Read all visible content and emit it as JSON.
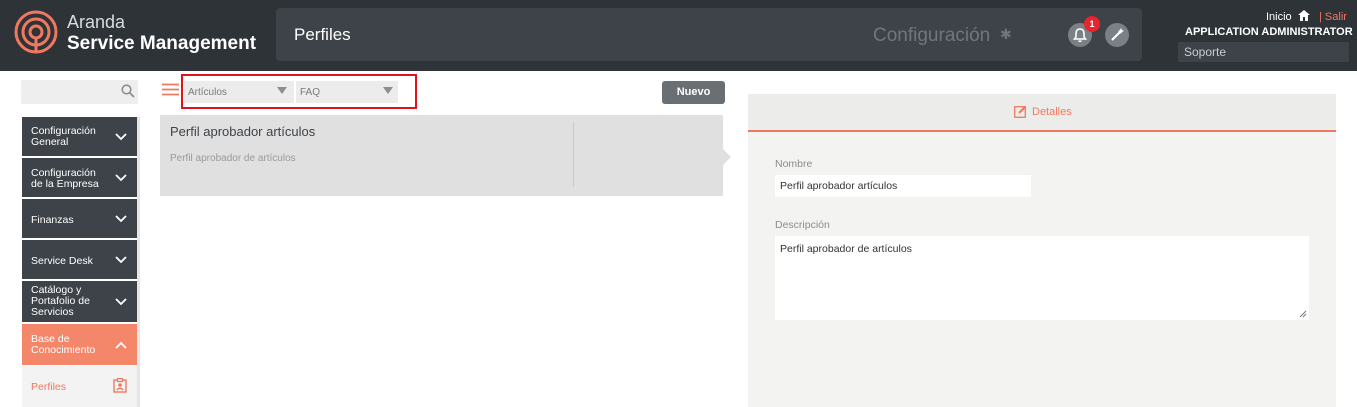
{
  "brand": {
    "line1": "Aranda",
    "line2": "Service Management"
  },
  "header": {
    "page_title": "Perfiles",
    "config_label": "Configuración",
    "notification_count": "1",
    "inicio": "Inicio",
    "salir": "Salir",
    "user_name": "APPLICATION ADMINISTRATOR",
    "role": "Soporte"
  },
  "sidebar": {
    "items": [
      {
        "label_l1": "Configuración",
        "label_l2": "General"
      },
      {
        "label_l1": "Configuración",
        "label_l2": "de la Empresa"
      },
      {
        "label_l1": "Finanzas"
      },
      {
        "label_l1": "Service Desk"
      },
      {
        "label_l1": "Catálogo y",
        "label_l2": "Portafolio de",
        "label_l3": "Servicios"
      },
      {
        "label_l1": "Base de",
        "label_l2": "Conocimiento"
      }
    ],
    "sub_item": "Perfiles"
  },
  "filters": {
    "type_value": "Artículos",
    "category_value": "FAQ"
  },
  "toolbar": {
    "new_label": "Nuevo"
  },
  "list": {
    "items": [
      {
        "title": "Perfil aprobador artículos",
        "description": "Perfil aprobador de artículos"
      }
    ]
  },
  "details": {
    "tab_label": "Detalles",
    "name_label": "Nombre",
    "name_value": "Perfil aprobador artículos",
    "description_label": "Descripción",
    "description_value": "Perfil aprobador de artículos"
  },
  "colors": {
    "accent": "#f07860",
    "header_bg": "#2e3338",
    "sidebar_bg": "#3d4349",
    "active_bg": "#f4876a"
  }
}
